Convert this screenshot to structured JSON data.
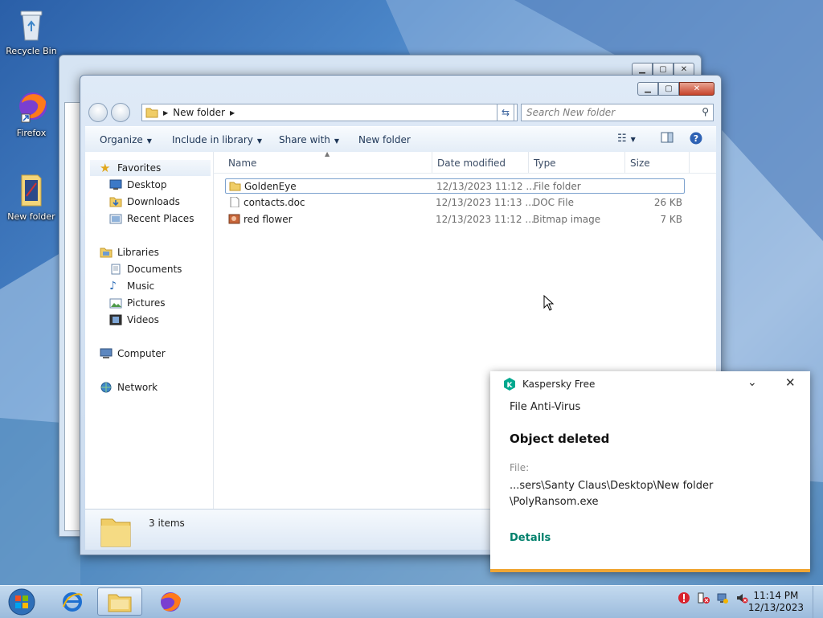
{
  "desktop": {
    "icons": [
      {
        "label": "Recycle Bin"
      },
      {
        "label": "Firefox"
      },
      {
        "label": "New folder"
      }
    ]
  },
  "explorer": {
    "address": {
      "segment": "New folder"
    },
    "search_placeholder": "Search New folder",
    "toolbar": {
      "organize": "Organize",
      "include_in_library": "Include in library",
      "share_with": "Share with",
      "new_folder": "New folder"
    },
    "nav": {
      "favorites": "Favorites",
      "desktop": "Desktop",
      "downloads": "Downloads",
      "recent_places": "Recent Places",
      "libraries": "Libraries",
      "documents": "Documents",
      "music": "Music",
      "pictures": "Pictures",
      "videos": "Videos",
      "computer": "Computer",
      "network": "Network"
    },
    "columns": {
      "name": "Name",
      "date": "Date modified",
      "type": "Type",
      "size": "Size"
    },
    "files": [
      {
        "name": "GoldenEye",
        "date": "12/13/2023 11:12 ...",
        "type": "File folder",
        "size": ""
      },
      {
        "name": "contacts.doc",
        "date": "12/13/2023 11:13 ...",
        "type": "DOC File",
        "size": "26 KB"
      },
      {
        "name": "red flower",
        "date": "12/13/2023 11:12 ...",
        "type": "Bitmap image",
        "size": "7 KB"
      }
    ],
    "status": "3 items"
  },
  "kaspersky": {
    "app": "Kaspersky Free",
    "component": "File Anti-Virus",
    "headline": "Object deleted",
    "file_label": "File:",
    "file_path_1": "...sers\\Santy Claus\\Desktop\\New folder",
    "file_path_2": "\\PolyRansom.exe",
    "details_link": "Details",
    "accent": "#00a88e"
  },
  "taskbar": {
    "time": "11:14 PM",
    "date": "12/13/2023"
  }
}
